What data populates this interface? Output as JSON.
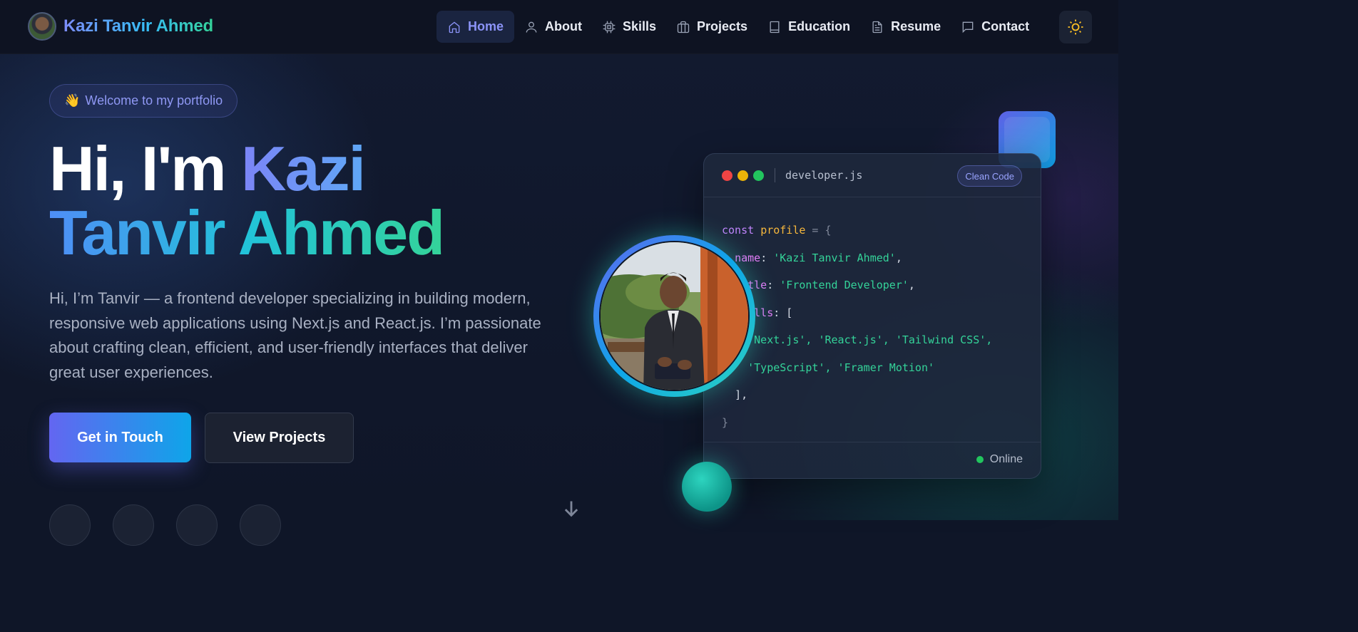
{
  "nav": {
    "brand_name": "Kazi Tanvir Ahmed",
    "items": [
      {
        "label": "Home",
        "icon": "home-icon",
        "active": true
      },
      {
        "label": "About",
        "icon": "user-icon",
        "active": false
      },
      {
        "label": "Skills",
        "icon": "cpu-icon",
        "active": false
      },
      {
        "label": "Projects",
        "icon": "briefcase-icon",
        "active": false
      },
      {
        "label": "Education",
        "icon": "book-icon",
        "active": false
      },
      {
        "label": "Resume",
        "icon": "file-text-icon",
        "active": false
      },
      {
        "label": "Contact",
        "icon": "message-icon",
        "active": false
      }
    ],
    "theme_toggle_icon": "sun-icon"
  },
  "hero": {
    "badge_emoji": "👋",
    "badge_text": "Welcome to my portfolio",
    "headline_plain": "Hi, I'm ",
    "headline_name_1": "Kazi",
    "headline_name_2": "Tanvir Ahmed",
    "intro": "Hi, I’m Tanvir — a frontend developer specializing in building modern, responsive web applications using Next.js and React.js. I’m passionate about crafting clean, efficient, and user-friendly interfaces that deliver great user experiences.",
    "primary_button": "Get in Touch",
    "secondary_button": "View Projects"
  },
  "code_card": {
    "filename": "developer.js",
    "tag": "Clean Code",
    "lines": {
      "l1_kw": "const",
      "l1_var": "profile",
      "l1_rest": " = {",
      "l2_prop": "name",
      "l2_val": "'Kazi Tanvir Ahmed'",
      "l3_prop": "title",
      "l3_val": "'Frontend Developer'",
      "l4_prop": "skills",
      "l5": "'Next.js', 'React.js', 'Tailwind CSS',",
      "l6": "'TypeScript', 'Framer Motion'",
      "l7": "],",
      "l8": "}"
    },
    "status": "Online"
  },
  "colors": {
    "accent_indigo": "#6366f1",
    "accent_sky": "#0ea5e9",
    "accent_green": "#34d399",
    "online": "#22c55e"
  }
}
